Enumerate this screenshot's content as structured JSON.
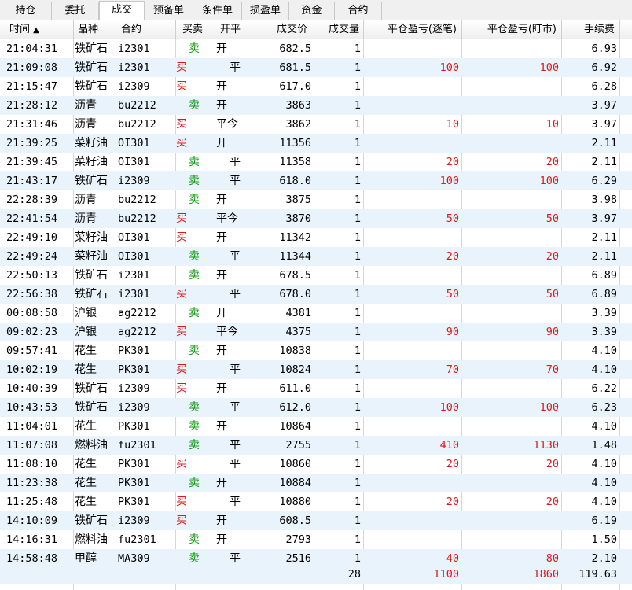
{
  "tabs": [
    "持仓",
    "委托",
    "成交",
    "预备单",
    "条件单",
    "损盈单",
    "资金",
    "合约"
  ],
  "active_tab": "成交",
  "columns": {
    "time": "时间",
    "sort_indicator": "▲",
    "variety": "品种",
    "contract": "合约",
    "side": "买卖",
    "openclose": "开平",
    "price": "成交价",
    "volume": "成交量",
    "pnl_trade": "平仓盈亏(逐笔)",
    "pnl_market": "平仓盈亏(盯市)",
    "fee": "手续费"
  },
  "colors": {
    "buy": "#e01818",
    "sell": "#0a9a0a",
    "pnl": "#e01818",
    "row_alt": "#e9f3fc"
  },
  "rows": [
    {
      "time": "21:04:31",
      "variety": "铁矿石",
      "contract": "i2301",
      "side": "卖",
      "oc": "开",
      "price": "682.5",
      "vol": "1",
      "pnl1": "",
      "pnl2": "",
      "fee": "6.93"
    },
    {
      "time": "21:09:08",
      "variety": "铁矿石",
      "contract": "i2301",
      "side": "买",
      "oc": "平",
      "price": "681.5",
      "vol": "1",
      "pnl1": "100",
      "pnl2": "100",
      "fee": "6.92"
    },
    {
      "time": "21:15:47",
      "variety": "铁矿石",
      "contract": "i2309",
      "side": "买",
      "oc": "开",
      "price": "617.0",
      "vol": "1",
      "pnl1": "",
      "pnl2": "",
      "fee": "6.28"
    },
    {
      "time": "21:28:12",
      "variety": "沥青",
      "contract": "bu2212",
      "side": "卖",
      "oc": "开",
      "price": "3863",
      "vol": "1",
      "pnl1": "",
      "pnl2": "",
      "fee": "3.97"
    },
    {
      "time": "21:31:46",
      "variety": "沥青",
      "contract": "bu2212",
      "side": "买",
      "oc": "平今",
      "price": "3862",
      "vol": "1",
      "pnl1": "10",
      "pnl2": "10",
      "fee": "3.97"
    },
    {
      "time": "21:39:25",
      "variety": "菜籽油",
      "contract": "OI301",
      "side": "买",
      "oc": "开",
      "price": "11356",
      "vol": "1",
      "pnl1": "",
      "pnl2": "",
      "fee": "2.11"
    },
    {
      "time": "21:39:45",
      "variety": "菜籽油",
      "contract": "OI301",
      "side": "卖",
      "oc": "平",
      "price": "11358",
      "vol": "1",
      "pnl1": "20",
      "pnl2": "20",
      "fee": "2.11"
    },
    {
      "time": "21:43:17",
      "variety": "铁矿石",
      "contract": "i2309",
      "side": "卖",
      "oc": "平",
      "price": "618.0",
      "vol": "1",
      "pnl1": "100",
      "pnl2": "100",
      "fee": "6.29"
    },
    {
      "time": "22:28:39",
      "variety": "沥青",
      "contract": "bu2212",
      "side": "卖",
      "oc": "开",
      "price": "3875",
      "vol": "1",
      "pnl1": "",
      "pnl2": "",
      "fee": "3.98"
    },
    {
      "time": "22:41:54",
      "variety": "沥青",
      "contract": "bu2212",
      "side": "买",
      "oc": "平今",
      "price": "3870",
      "vol": "1",
      "pnl1": "50",
      "pnl2": "50",
      "fee": "3.97"
    },
    {
      "time": "22:49:10",
      "variety": "菜籽油",
      "contract": "OI301",
      "side": "买",
      "oc": "开",
      "price": "11342",
      "vol": "1",
      "pnl1": "",
      "pnl2": "",
      "fee": "2.11"
    },
    {
      "time": "22:49:24",
      "variety": "菜籽油",
      "contract": "OI301",
      "side": "卖",
      "oc": "平",
      "price": "11344",
      "vol": "1",
      "pnl1": "20",
      "pnl2": "20",
      "fee": "2.11"
    },
    {
      "time": "22:50:13",
      "variety": "铁矿石",
      "contract": "i2301",
      "side": "卖",
      "oc": "开",
      "price": "678.5",
      "vol": "1",
      "pnl1": "",
      "pnl2": "",
      "fee": "6.89"
    },
    {
      "time": "22:56:38",
      "variety": "铁矿石",
      "contract": "i2301",
      "side": "买",
      "oc": "平",
      "price": "678.0",
      "vol": "1",
      "pnl1": "50",
      "pnl2": "50",
      "fee": "6.89"
    },
    {
      "time": "00:08:58",
      "variety": "沪银",
      "contract": "ag2212",
      "side": "卖",
      "oc": "开",
      "price": "4381",
      "vol": "1",
      "pnl1": "",
      "pnl2": "",
      "fee": "3.39"
    },
    {
      "time": "09:02:23",
      "variety": "沪银",
      "contract": "ag2212",
      "side": "买",
      "oc": "平今",
      "price": "4375",
      "vol": "1",
      "pnl1": "90",
      "pnl2": "90",
      "fee": "3.39"
    },
    {
      "time": "09:57:41",
      "variety": "花生",
      "contract": "PK301",
      "side": "卖",
      "oc": "开",
      "price": "10838",
      "vol": "1",
      "pnl1": "",
      "pnl2": "",
      "fee": "4.10"
    },
    {
      "time": "10:02:19",
      "variety": "花生",
      "contract": "PK301",
      "side": "买",
      "oc": "平",
      "price": "10824",
      "vol": "1",
      "pnl1": "70",
      "pnl2": "70",
      "fee": "4.10"
    },
    {
      "time": "10:40:39",
      "variety": "铁矿石",
      "contract": "i2309",
      "side": "买",
      "oc": "开",
      "price": "611.0",
      "vol": "1",
      "pnl1": "",
      "pnl2": "",
      "fee": "6.22"
    },
    {
      "time": "10:43:53",
      "variety": "铁矿石",
      "contract": "i2309",
      "side": "卖",
      "oc": "平",
      "price": "612.0",
      "vol": "1",
      "pnl1": "100",
      "pnl2": "100",
      "fee": "6.23"
    },
    {
      "time": "11:04:01",
      "variety": "花生",
      "contract": "PK301",
      "side": "卖",
      "oc": "开",
      "price": "10864",
      "vol": "1",
      "pnl1": "",
      "pnl2": "",
      "fee": "4.10"
    },
    {
      "time": "11:07:08",
      "variety": "燃料油",
      "contract": "fu2301",
      "side": "卖",
      "oc": "平",
      "price": "2755",
      "vol": "1",
      "pnl1": "410",
      "pnl2": "1130",
      "fee": "1.48"
    },
    {
      "time": "11:08:10",
      "variety": "花生",
      "contract": "PK301",
      "side": "买",
      "oc": "平",
      "price": "10860",
      "vol": "1",
      "pnl1": "20",
      "pnl2": "20",
      "fee": "4.10"
    },
    {
      "time": "11:23:38",
      "variety": "花生",
      "contract": "PK301",
      "side": "卖",
      "oc": "开",
      "price": "10884",
      "vol": "1",
      "pnl1": "",
      "pnl2": "",
      "fee": "4.10"
    },
    {
      "time": "11:25:48",
      "variety": "花生",
      "contract": "PK301",
      "side": "买",
      "oc": "平",
      "price": "10880",
      "vol": "1",
      "pnl1": "20",
      "pnl2": "20",
      "fee": "4.10"
    },
    {
      "time": "14:10:09",
      "variety": "铁矿石",
      "contract": "i2309",
      "side": "买",
      "oc": "开",
      "price": "608.5",
      "vol": "1",
      "pnl1": "",
      "pnl2": "",
      "fee": "6.19"
    },
    {
      "time": "14:16:31",
      "variety": "燃料油",
      "contract": "fu2301",
      "side": "卖",
      "oc": "开",
      "price": "2793",
      "vol": "1",
      "pnl1": "",
      "pnl2": "",
      "fee": "1.50"
    },
    {
      "time": "14:58:48",
      "variety": "甲醇",
      "contract": "MA309",
      "side": "卖",
      "oc": "平",
      "price": "2516",
      "vol": "1",
      "pnl1": "40",
      "pnl2": "80",
      "fee": "2.10"
    }
  ],
  "totals": {
    "vol": "28",
    "pnl1": "1100",
    "pnl2": "1860",
    "fee": "119.63"
  }
}
